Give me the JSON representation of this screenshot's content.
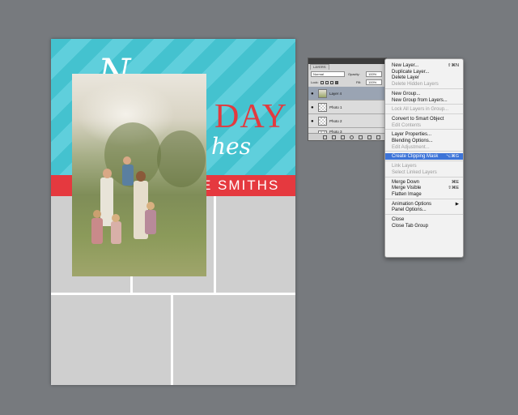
{
  "document": {
    "title_script": "N",
    "title_day": "DAY",
    "title_wishes": "hes",
    "name_band": "E SMITHS",
    "colors": {
      "stripe_a": "#44c2cf",
      "stripe_b": "#5fcfdc",
      "band": "#e5393f",
      "title_accent": "#e23a3f",
      "placeholder": "#cfcfcf"
    }
  },
  "layers_panel": {
    "tab_label": "LAYERS",
    "blend_mode": "Normal",
    "opacity_label": "Opacity:",
    "opacity_value": "100%",
    "lock_label": "Lock:",
    "fill_label": "Fill:",
    "fill_value": "100%",
    "layers": [
      {
        "name": "Layer 4",
        "selected": true,
        "thumb": "photo"
      },
      {
        "name": "Photo 1",
        "selected": false,
        "thumb": "transparent"
      },
      {
        "name": "Photo 2",
        "selected": false,
        "thumb": "transparent"
      },
      {
        "name": "Photo 3",
        "selected": false,
        "thumb": "transparent"
      }
    ],
    "footer_icons": [
      "link-icon",
      "fx-icon",
      "mask-icon",
      "adjustment-icon",
      "folder-icon",
      "new-layer-icon",
      "trash-icon"
    ]
  },
  "context_menu": {
    "items": [
      {
        "label": "New Layer...",
        "shortcut": "⇧⌘N",
        "disabled": false
      },
      {
        "label": "Duplicate Layer...",
        "shortcut": "",
        "disabled": false
      },
      {
        "label": "Delete Layer",
        "shortcut": "",
        "disabled": false
      },
      {
        "label": "Delete Hidden Layers",
        "shortcut": "",
        "disabled": true
      },
      {
        "sep": true
      },
      {
        "label": "New Group...",
        "shortcut": "",
        "disabled": false
      },
      {
        "label": "New Group from Layers...",
        "shortcut": "",
        "disabled": false
      },
      {
        "sep": true
      },
      {
        "label": "Lock All Layers in Group...",
        "shortcut": "",
        "disabled": true
      },
      {
        "sep": true
      },
      {
        "label": "Convert to Smart Object",
        "shortcut": "",
        "disabled": false
      },
      {
        "label": "Edit Contents",
        "shortcut": "",
        "disabled": true
      },
      {
        "sep": true
      },
      {
        "label": "Layer Properties...",
        "shortcut": "",
        "disabled": false
      },
      {
        "label": "Blending Options...",
        "shortcut": "",
        "disabled": false
      },
      {
        "label": "Edit Adjustment...",
        "shortcut": "",
        "disabled": true
      },
      {
        "sep": true
      },
      {
        "label": "Create Clipping Mask",
        "shortcut": "⌥⌘G",
        "disabled": false,
        "highlight": true
      },
      {
        "sep": true
      },
      {
        "label": "Link Layers",
        "shortcut": "",
        "disabled": true
      },
      {
        "label": "Select Linked Layers",
        "shortcut": "",
        "disabled": true
      },
      {
        "sep": true
      },
      {
        "label": "Merge Down",
        "shortcut": "⌘E",
        "disabled": false
      },
      {
        "label": "Merge Visible",
        "shortcut": "⇧⌘E",
        "disabled": false
      },
      {
        "label": "Flatten Image",
        "shortcut": "",
        "disabled": false
      },
      {
        "sep": true
      },
      {
        "label": "Animation Options",
        "shortcut": "▶",
        "disabled": false
      },
      {
        "label": "Panel Options...",
        "shortcut": "",
        "disabled": false
      },
      {
        "sep": true
      },
      {
        "label": "Close",
        "shortcut": "",
        "disabled": false
      },
      {
        "label": "Close Tab Group",
        "shortcut": "",
        "disabled": false
      }
    ]
  }
}
